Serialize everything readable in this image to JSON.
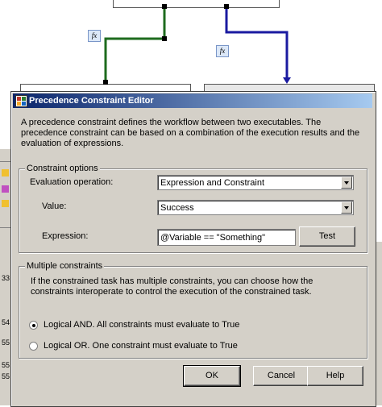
{
  "dialog": {
    "title": "Precedence Constraint Editor",
    "description": "A precedence constraint defines the workflow between two executables. The precedence constraint can be based on a combination of the execution results and the evaluation of expressions."
  },
  "constraint_options": {
    "legend": "Constraint options",
    "evaluation_operation_label": "Evaluation operation:",
    "evaluation_operation_value": "Expression and Constraint",
    "value_label": "Value:",
    "value_value": "Success",
    "expression_label": "Expression:",
    "expression_value": "@Variable == \"Something\"",
    "test_button": "Test"
  },
  "multiple_constraints": {
    "legend": "Multiple constraints",
    "description": "If the constrained task has multiple constraints, you can choose how the constraints interoperate to control the execution of the constrained task.",
    "option_and": "Logical AND. All constraints must evaluate to True",
    "option_or": "Logical OR. One constraint must evaluate to True",
    "selected": "and"
  },
  "buttons": {
    "ok": "OK",
    "cancel": "Cancel",
    "help": "Help"
  },
  "background": {
    "fx_label": "fx",
    "line_numbers": [
      "33",
      "54",
      "55",
      "55",
      "55"
    ],
    "connector_colors": {
      "success": "#1e6b1e",
      "expression": "#1a1aa0"
    }
  }
}
